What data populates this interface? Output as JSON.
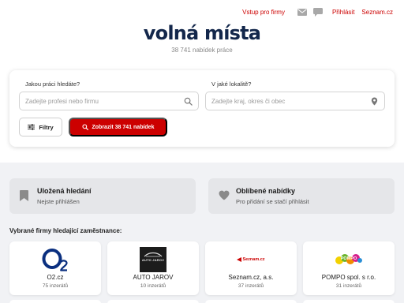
{
  "nav": {
    "login_label": "Vstup pro firmy",
    "signin_label": "Přihlásit",
    "brand_label": "Seznam.cz",
    "icons": [
      "mail-icon",
      "chat-icon"
    ]
  },
  "header": {
    "logo": "volná místa",
    "count_text": "38 741 nabídek práce"
  },
  "search": {
    "what_label": "Jakou práci hledáte?",
    "what_placeholder": "Zadejte profesi nebo firmu",
    "what_value": "",
    "where_label": "V jaké lokalitě?",
    "where_placeholder": "Zadejte kraj, okres či obec",
    "where_value": "",
    "filter_label": "Filtry",
    "submit_label": "Zobrazit 38 741 nabídek"
  },
  "quick": {
    "saved_title": "Uložená hledání",
    "saved_sub": "Nejste přihlášen",
    "fav_title": "Oblíbené nabídky",
    "fav_sub": "Pro přidání se stačí přihlásit"
  },
  "firms": {
    "heading": "Vybrané firmy hledající zaměstnance:",
    "items": [
      {
        "name": "O2.cz",
        "count": "75 inzerátů",
        "logo_text": "O2"
      },
      {
        "name": "AUTO JAROV",
        "count": "10 inzerátů",
        "logo_text": "AUTO JAROV"
      },
      {
        "name": "Seznam.cz, a.s.",
        "count": "37 inzerátů",
        "logo_text": "Seznam.cz"
      },
      {
        "name": "POMPO spol. s r.o.",
        "count": "31 inzerátů",
        "logo_text": "POMPO"
      }
    ]
  },
  "colors": {
    "accent": "#cc0000",
    "logo": "#13274b",
    "o2_blue": "#0a2f7f"
  }
}
